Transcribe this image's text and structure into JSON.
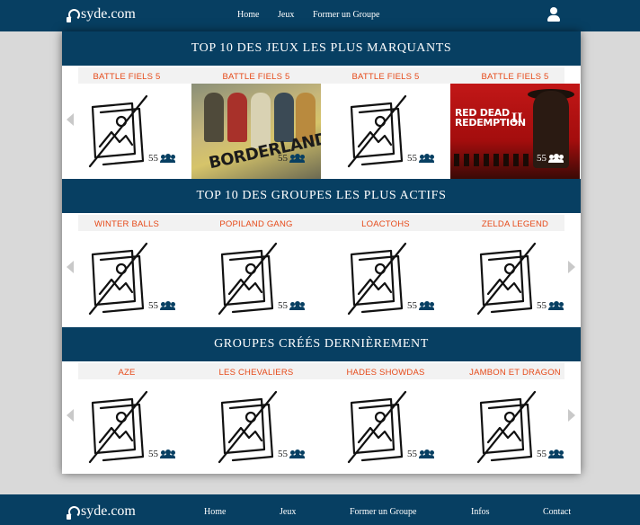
{
  "header": {
    "logo": "syde.com",
    "nav": [
      "Home",
      "Jeux",
      "Former un Groupe"
    ],
    "user_icon": "user-icon"
  },
  "sections": [
    {
      "title": "TOP 10 DES JEUX LES PLUS MARQUANTS",
      "cards": [
        {
          "name": "BATTLE FIELS 5",
          "count": "55",
          "image": "placeholder"
        },
        {
          "name": "BATTLE FIELS 5",
          "count": "55",
          "image": "borderlands"
        },
        {
          "name": "BATTLE FIELS 5",
          "count": "55",
          "image": "placeholder"
        },
        {
          "name": "BATTLE FIELS 5",
          "count": "55",
          "image": "red-dead"
        }
      ]
    },
    {
      "title": "TOP 10 DES GROUPES LES PLUS ACTIFS",
      "cards": [
        {
          "name": "WINTER BALLS",
          "count": "55",
          "image": "placeholder"
        },
        {
          "name": "POPILAND GANG",
          "count": "55",
          "image": "placeholder"
        },
        {
          "name": "LOACTOHS",
          "count": "55",
          "image": "placeholder"
        },
        {
          "name": "ZELDA LEGEND",
          "count": "55",
          "image": "placeholder"
        }
      ]
    },
    {
      "title": "GROUPES CRÉÉS DERNIÈREMENT",
      "cards": [
        {
          "name": "AZE",
          "count": "55",
          "image": "placeholder"
        },
        {
          "name": "LES CHEVALIERS",
          "count": "55",
          "image": "placeholder"
        },
        {
          "name": "HADES SHOWDAS",
          "count": "55",
          "image": "placeholder"
        },
        {
          "name": "JAMBON ET DRAGON",
          "count": "55",
          "image": "placeholder"
        }
      ]
    }
  ],
  "art": {
    "borderlands_logo_a": "BORDERLANDS",
    "borderlands_logo_b": "2",
    "rdr_title_a": "RED DEAD",
    "rdr_title_b": "REDEMPTION",
    "rdr_title_c": "II"
  },
  "footer": {
    "logo": "syde.com",
    "nav": [
      "Home",
      "Jeux",
      "Former un Groupe",
      "Infos",
      "Contact"
    ]
  },
  "colors": {
    "navy": "#073f62",
    "accent": "#e64a19",
    "page_bg": "#d9d9d9"
  }
}
